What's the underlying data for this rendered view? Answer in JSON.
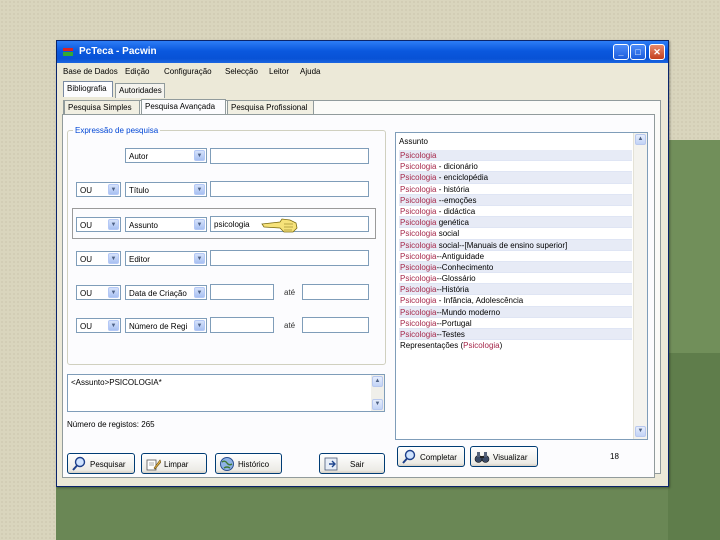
{
  "window": {
    "title": "PcTeca - Pacwin"
  },
  "menu": [
    "Base de Dados",
    "Edição",
    "Configuração",
    "Selecção",
    "Leitor",
    "Ajuda"
  ],
  "top_tabs": [
    "Bibliografia",
    "Autoridades"
  ],
  "sub_tabs": [
    "Pesquisa Simples",
    "Pesquisa Avançada",
    "Pesquisa Profissional"
  ],
  "search": {
    "group_title": "Expressão de pesquisa",
    "rows": [
      {
        "operator": "",
        "field": "Autor",
        "value": "",
        "until": ""
      },
      {
        "operator": "OU",
        "field": "Título",
        "value": "",
        "until": ""
      },
      {
        "operator": "OU",
        "field": "Assunto",
        "value": "psicologia",
        "until": ""
      },
      {
        "operator": "OU",
        "field": "Editor",
        "value": "",
        "until": ""
      },
      {
        "operator": "OU",
        "field": "Data de Criação",
        "value": "",
        "until": "até"
      },
      {
        "operator": "OU",
        "field": "Número de Regi",
        "value": "",
        "until": "até"
      }
    ],
    "expression": "<Assunto>PSICOLOGIA*",
    "record_count": "Número de registos: 265"
  },
  "buttons": {
    "search": "Pesquisar",
    "clear": "Limpar",
    "history": "Histórico",
    "exit": "Sair",
    "complete": "Completar",
    "view": "Visualizar"
  },
  "subject_list": {
    "header": "Assunto",
    "items": [
      {
        "term": "Psicologia",
        "rest": ""
      },
      {
        "term": "Psicologia",
        "rest": " - dicionário"
      },
      {
        "term": "Psicologia",
        "rest": " - enciclopédia"
      },
      {
        "term": "Psicologia",
        "rest": " - história"
      },
      {
        "term": "Psicologia",
        "rest": " --emoções"
      },
      {
        "term": "Psicologia",
        "rest": " - didáctica"
      },
      {
        "term": "Psicologia",
        "rest": " genética"
      },
      {
        "term": "Psicologia",
        "rest": " social"
      },
      {
        "term": "Psicologia",
        "rest": " social--[Manuais de ensino superior]"
      },
      {
        "term": "Psicologia",
        "rest": "--Antiguidade"
      },
      {
        "term": "Psicologia",
        "rest": "--Conhecimento"
      },
      {
        "term": "Psicologia",
        "rest": "--Glossário"
      },
      {
        "term": "Psicologia",
        "rest": "--História"
      },
      {
        "term": "Psicologia",
        "rest": " - Infância, Adolescência"
      },
      {
        "term": "Psicologia",
        "rest": "--Mundo moderno"
      },
      {
        "term": "Psicologia",
        "rest": "--Portugal"
      },
      {
        "term": "Psicologia",
        "rest": "--Testes"
      },
      {
        "prefix": "Representações (",
        "term": "Psicologia",
        "rest": ")"
      }
    ],
    "count": "18"
  }
}
